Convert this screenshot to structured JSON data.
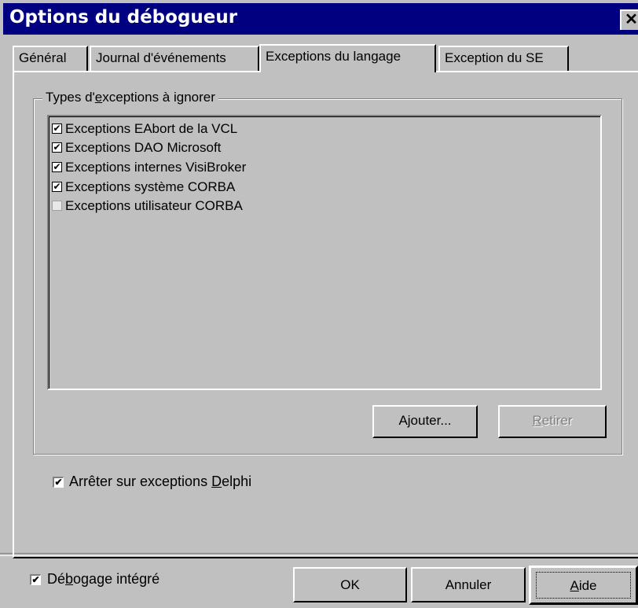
{
  "window": {
    "title": "Options du débogueur",
    "close_glyph": "✕"
  },
  "tabs": [
    {
      "label": "Général"
    },
    {
      "label": "Journal d'événements"
    },
    {
      "label": "Exceptions du langage"
    },
    {
      "label": "Exception du SE"
    }
  ],
  "group": {
    "label_pre": "Types d'",
    "label_accel": "e",
    "label_post": "xceptions à ignorer"
  },
  "exceptions": [
    {
      "label": "Exceptions EAbort de la VCL",
      "checked": true
    },
    {
      "label": "Exceptions DAO Microsoft",
      "checked": true
    },
    {
      "label": "Exceptions internes VisiBroker",
      "checked": true
    },
    {
      "label": "Exceptions système CORBA",
      "checked": true
    },
    {
      "label": "Exceptions utilisateur CORBA",
      "checked": false
    }
  ],
  "buttons": {
    "add": "Ajouter...",
    "remove_accel": "R",
    "remove_rest": "etirer",
    "ok": "OK",
    "cancel": "Annuler",
    "help_accel": "A",
    "help_rest": "ide"
  },
  "stop_on_delphi": {
    "pre": "Arrêter sur exceptions ",
    "accel": "D",
    "post": "elphi",
    "checked": true
  },
  "integrated_debug": {
    "pre": "Dé",
    "accel": "b",
    "post": "ogage intégré",
    "checked": true
  },
  "check_glyph": "✔"
}
